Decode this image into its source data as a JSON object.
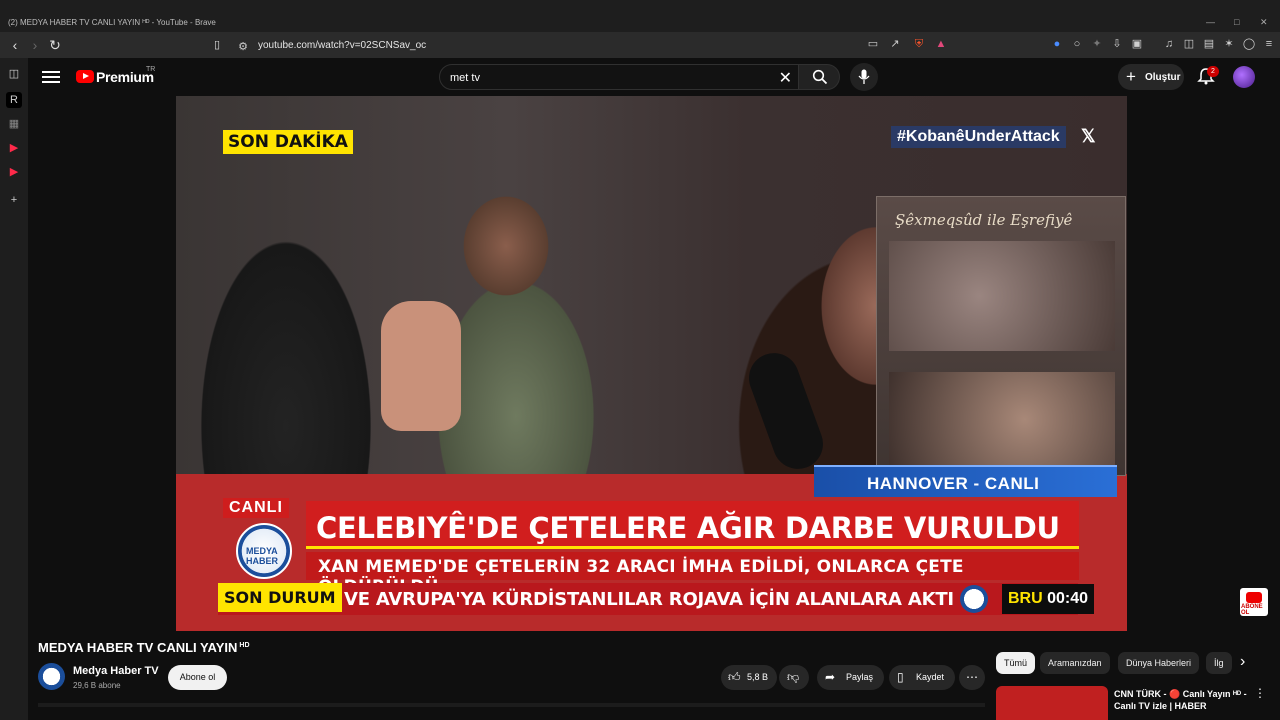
{
  "browser": {
    "window_title": "(2) MEDYA HABER TV CANLI YAYIN ᴴᴰ - YouTube - Brave",
    "url": "youtube.com/watch?v=02SCNSav_oc"
  },
  "youtube": {
    "brand": "Premium",
    "brand_region": "TR",
    "search_query": "met tv",
    "create_label": "Oluştur",
    "notifications": "2"
  },
  "video": {
    "son_dakika": "SON DAKİKA",
    "hashtag": "#KobanêUnderAttack",
    "poster_text": "Şêxmeqsûd ile Eşrefiyê",
    "location": "HANNOVER - CANLI",
    "canli": "CANLI",
    "logo_text": "MEDYA HABER",
    "headline": "CELEBIYÊ'DE ÇETELERE AĞIR DARBE VURULDU",
    "subheadline": "XAN MEMED'DE ÇETELERİN 32 ARACI İMHA EDİLDİ, ONLARCA ÇETE ÖLDÜRÜLDÜ",
    "ticker_tag": "SON DURUM",
    "ticker_text": "VE AVRUPA'YA KÜRDİSTANLILAR ROJAVA İÇİN ALANLARA AKTI",
    "clock_tz": "BRU",
    "clock_time": "00:40",
    "subscribe_badge": "ABONE OL"
  },
  "below": {
    "title": "MEDYA HABER TV CANLI YAYIN",
    "title_badge": "HD",
    "channel_name": "Medya Haber TV",
    "channel_subs": "29,6 B abone",
    "subscribe": "Abone ol",
    "likes": "5,8 B",
    "share": "Paylaş",
    "save": "Kaydet"
  },
  "chips": [
    "Tümü",
    "Aramanızdan",
    "Dünya Haberleri",
    "İlg"
  ],
  "recommendation": {
    "title": "CNN TÜRK - 🔴 Canlı Yayın ᴴᴰ - Canlı TV izle | HABER"
  },
  "colors": {
    "accent_red": "#ff0000",
    "lower_third_red": "#d11e1e",
    "tag_yellow": "#ffe400",
    "location_blue": "#1a4fa8"
  }
}
